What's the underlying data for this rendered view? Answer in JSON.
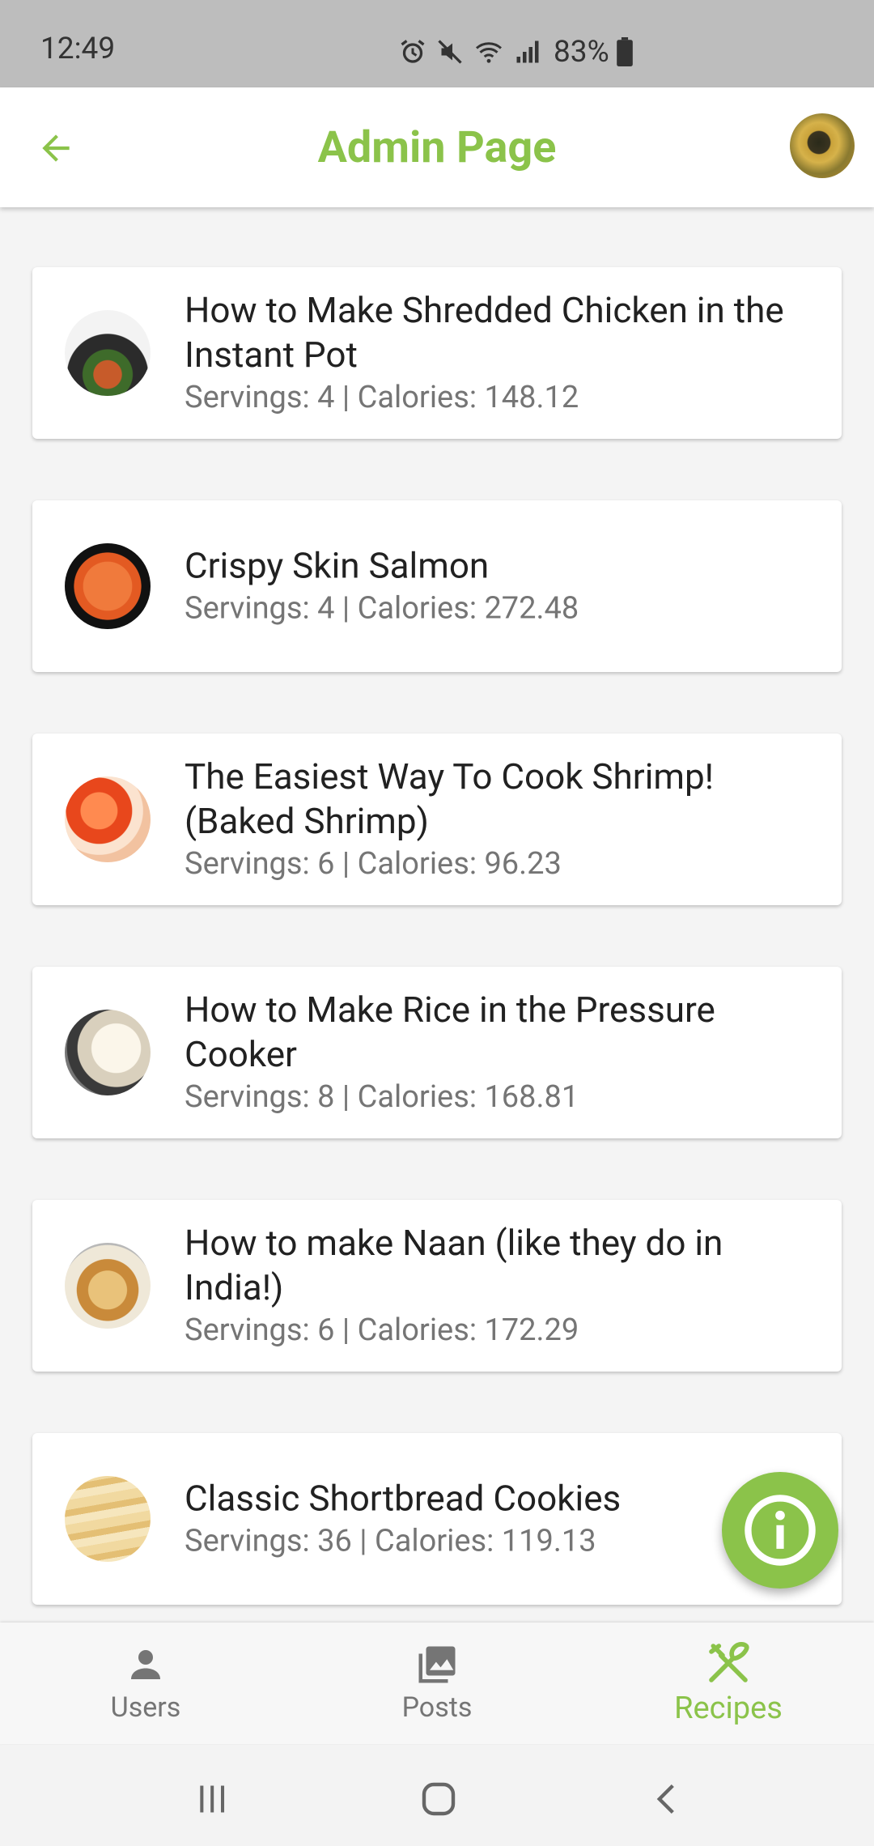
{
  "status_bar": {
    "time": "12:49",
    "battery": "83%"
  },
  "app_bar": {
    "title": "Admin Page",
    "accent_color": "#8bc34a"
  },
  "recipes": [
    {
      "title": "How to Make Shredded Chicken in the Instant Pot",
      "subtitle": "Servings: 4 | Calories: 148.12"
    },
    {
      "title": "Crispy Skin Salmon",
      "subtitle": "Servings: 4 | Calories: 272.48"
    },
    {
      "title": "The Easiest Way To Cook Shrimp! (Baked Shrimp)",
      "subtitle": "Servings: 6 | Calories: 96.23"
    },
    {
      "title": "How to Make Rice in the Pressure Cooker",
      "subtitle": "Servings: 8 | Calories: 168.81"
    },
    {
      "title": "How to make Naan (like they do in India!)",
      "subtitle": "Servings: 6 | Calories: 172.29"
    },
    {
      "title": "Classic Shortbread Cookies",
      "subtitle": "Servings: 36 | Calories: 119.13"
    }
  ],
  "bottom_nav": {
    "users_label": "Users",
    "posts_label": "Posts",
    "recipes_label": "Recipes",
    "active_tab": "Recipes"
  },
  "icons": {
    "back": "arrow-left-icon",
    "fab": "info-icon",
    "users": "person-icon",
    "posts": "photo-library-icon",
    "recipes": "fork-knife-icon"
  }
}
